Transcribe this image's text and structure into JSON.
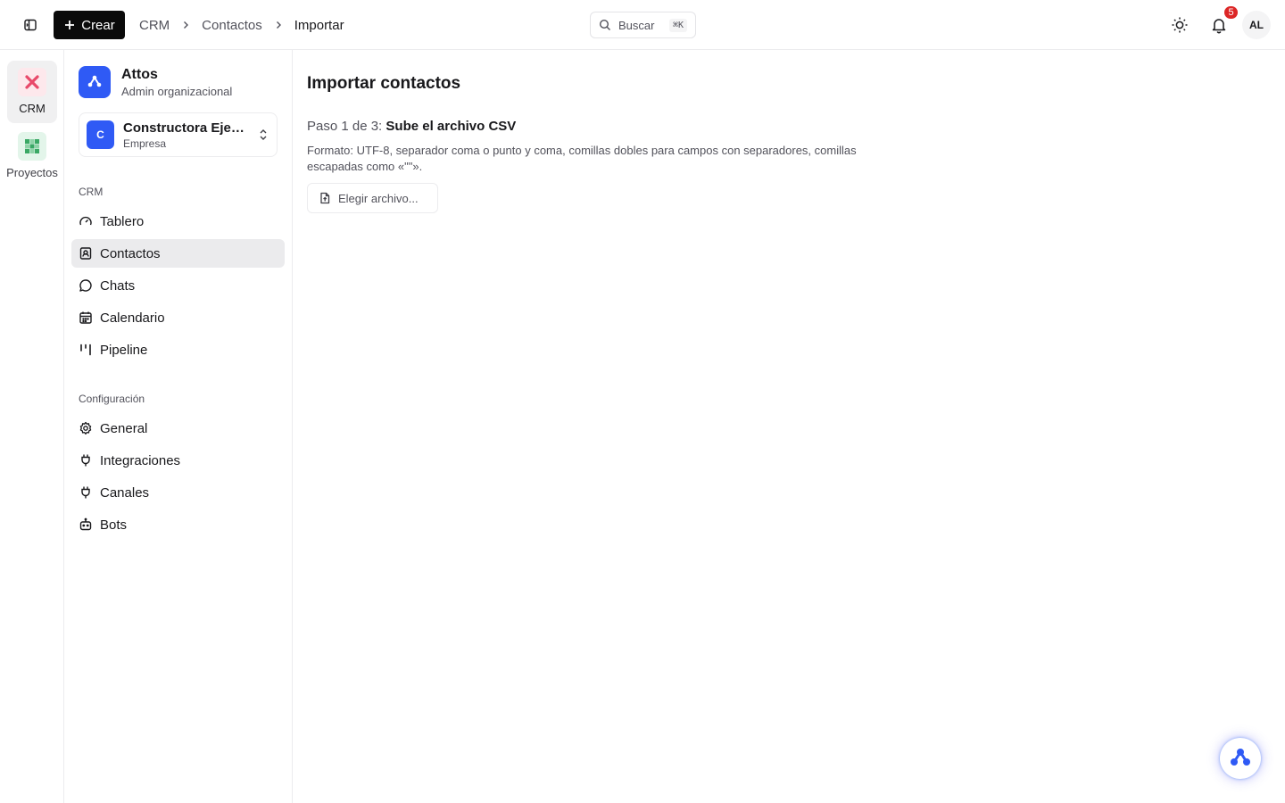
{
  "topbar": {
    "create_label": "Crear",
    "breadcrumb": [
      "CRM",
      "Contactos",
      "Importar"
    ],
    "search_label": "Buscar",
    "search_shortcut": "⌘K",
    "notification_count": "5",
    "avatar_initials": "AL"
  },
  "rail": {
    "items": [
      {
        "label": "CRM",
        "icon": "crm-x-icon",
        "color": "#e8496a"
      },
      {
        "label": "Proyectos",
        "icon": "projects-grid-icon",
        "color": "#3aa865"
      }
    ]
  },
  "sidebar": {
    "org_name": "Attos",
    "org_role": "Admin organizacional",
    "company_initial": "C",
    "company_name": "Constructora Ejemplo",
    "company_type": "Empresa",
    "sections": [
      {
        "label": "CRM",
        "items": [
          {
            "label": "Tablero",
            "icon": "gauge-icon"
          },
          {
            "label": "Contactos",
            "icon": "contact-icon",
            "active": true
          },
          {
            "label": "Chats",
            "icon": "chat-bubble-icon"
          },
          {
            "label": "Calendario",
            "icon": "calendar-icon"
          },
          {
            "label": "Pipeline",
            "icon": "pipeline-icon"
          }
        ]
      },
      {
        "label": "Configuración",
        "items": [
          {
            "label": "General",
            "icon": "gear-icon"
          },
          {
            "label": "Integraciones",
            "icon": "plug-icon"
          },
          {
            "label": "Canales",
            "icon": "plug-icon"
          },
          {
            "label": "Bots",
            "icon": "bot-icon"
          }
        ]
      }
    ]
  },
  "main": {
    "title": "Importar contactos",
    "step_prefix": "Paso 1 de 3:",
    "step_title": "Sube el archivo CSV",
    "format_text": "Formato: UTF-8, separador coma o punto y coma, comillas dobles para campos con separadores, comillas escapadas como «\"\"».",
    "choose_file_label": "Elegir archivo..."
  },
  "colors": {
    "brand": "#2f5af5",
    "crm_accent": "#e8496a",
    "projects_accent": "#3aa865",
    "badge": "#dc2626"
  }
}
